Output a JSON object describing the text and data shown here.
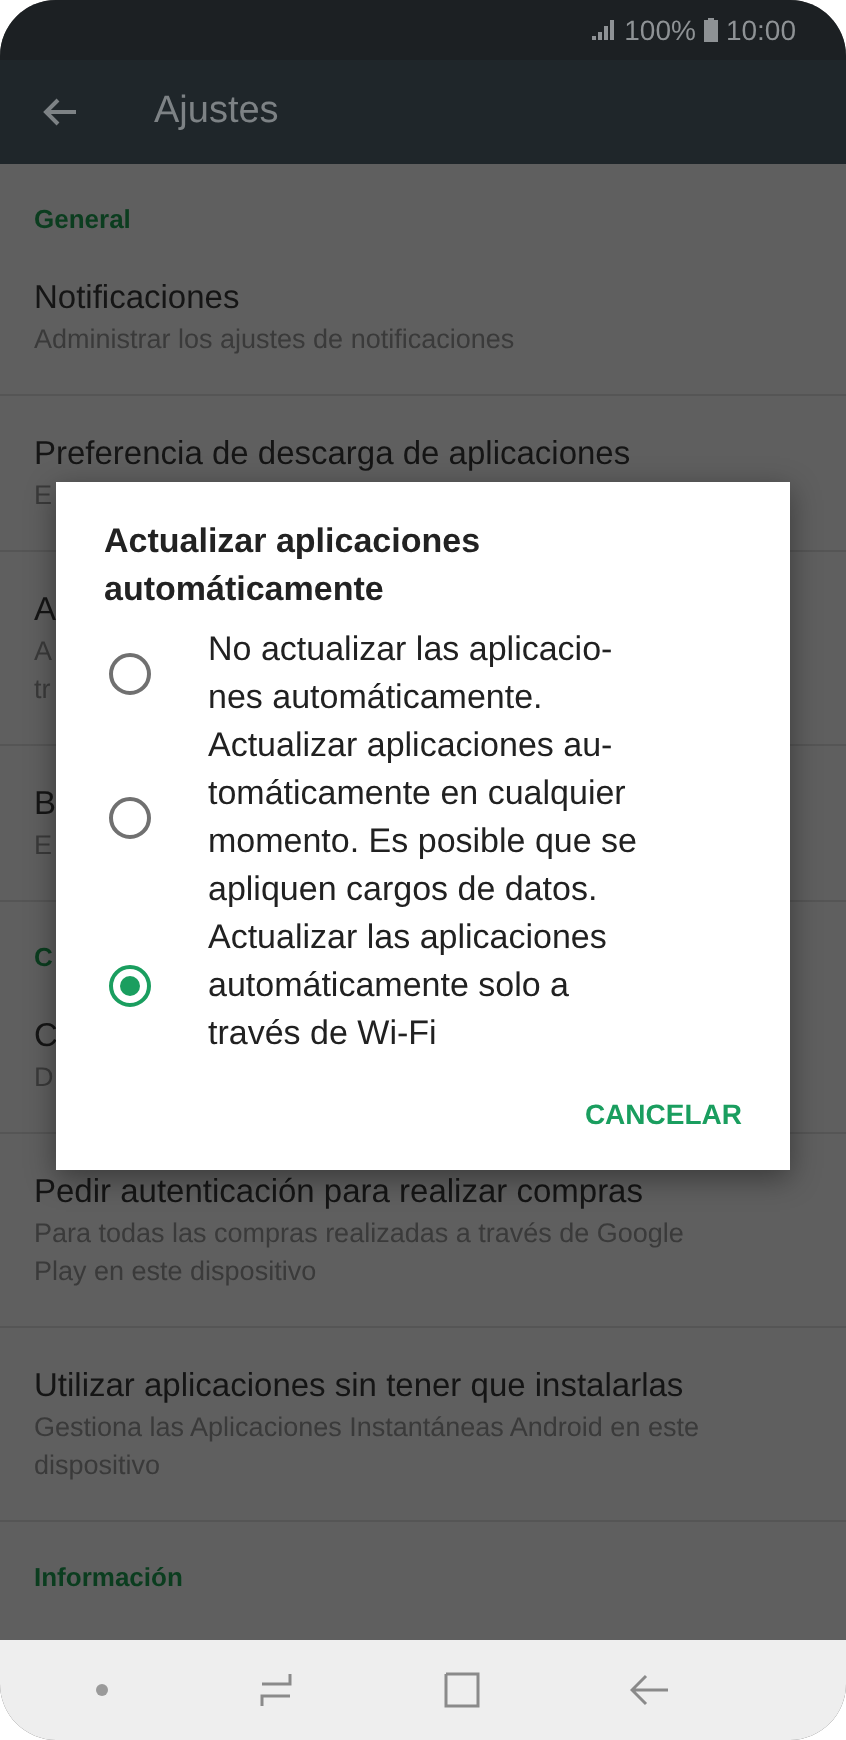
{
  "status_bar": {
    "battery": "100%",
    "time": "10:00"
  },
  "header": {
    "title": "Ajustes"
  },
  "sections": [
    {
      "title": "General",
      "items": [
        {
          "title": "Notificaciones",
          "subtitle": "Administrar los ajustes de notificaciones"
        },
        {
          "title": "Preferencia de descarga de aplicaciones",
          "subtitle": "E"
        },
        {
          "title": "A",
          "subtitle": "A\ntr"
        },
        {
          "title": "B",
          "subtitle": "E"
        }
      ]
    },
    {
      "title": "C",
      "items": [
        {
          "title": "C",
          "subtitle": "D"
        },
        {
          "title": "Pedir autenticación para realizar compras",
          "subtitle": "Para todas las compras realizadas a través de Google\nPlay en este dispositivo"
        },
        {
          "title": "Utilizar aplicaciones sin tener que instalarlas",
          "subtitle": "Gestiona las Aplicaciones Instantáneas Android en este\ndispositivo"
        }
      ]
    },
    {
      "title": "Información"
    }
  ],
  "dialog": {
    "title": "Actualizar aplicaciones\nautomáticamente",
    "options": [
      {
        "label": "No actualizar las aplicacio-\nnes automáticamente.",
        "selected": false
      },
      {
        "label": "Actualizar aplicaciones au-\ntomáticamente en cualquier\nmomento. Es posible que se\napliquen cargos de datos.",
        "selected": false
      },
      {
        "label": "Actualizar las aplicaciones\nautomáticamente solo a\ntravés de Wi-Fi",
        "selected": true
      }
    ],
    "button": "CANCELAR"
  }
}
